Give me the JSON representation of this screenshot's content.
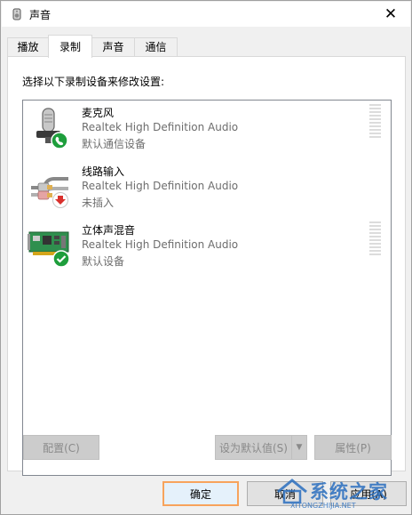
{
  "window": {
    "title": "声音",
    "close_glyph": "✕"
  },
  "tabs": [
    {
      "label": "播放"
    },
    {
      "label": "录制",
      "active": true
    },
    {
      "label": "声音"
    },
    {
      "label": "通信"
    }
  ],
  "instruction": "选择以下录制设备来修改设置:",
  "devices": [
    {
      "name": "麦克风",
      "driver": "Realtek High Definition Audio",
      "status": "默认通信设备",
      "icon": "microphone-icon",
      "badge": "phone-badge-icon",
      "has_meter": true
    },
    {
      "name": "线路输入",
      "driver": "Realtek High Definition Audio",
      "status": "未插入",
      "icon": "line-in-cable-icon",
      "badge": "down-arrow-badge-icon",
      "has_meter": false
    },
    {
      "name": "立体声混音",
      "driver": "Realtek High Definition Audio",
      "status": "默认设备",
      "icon": "sound-card-icon",
      "badge": "checkmark-badge-icon",
      "has_meter": true
    }
  ],
  "buttons": {
    "configure": "配置(C)",
    "set_default": "设为默认值(S)",
    "set_default_arrow": "▼",
    "properties": "属性(P)",
    "ok": "确定",
    "cancel": "取消",
    "apply": "应用(A)"
  },
  "watermark": {
    "text": "系统之家",
    "url": "XITONGZHIJIA.NET"
  },
  "colors": {
    "accent_border": "#f7a35c",
    "badge_green": "#1e9e3c",
    "badge_red": "#d9302c",
    "watermark": "#2a6fbf"
  }
}
